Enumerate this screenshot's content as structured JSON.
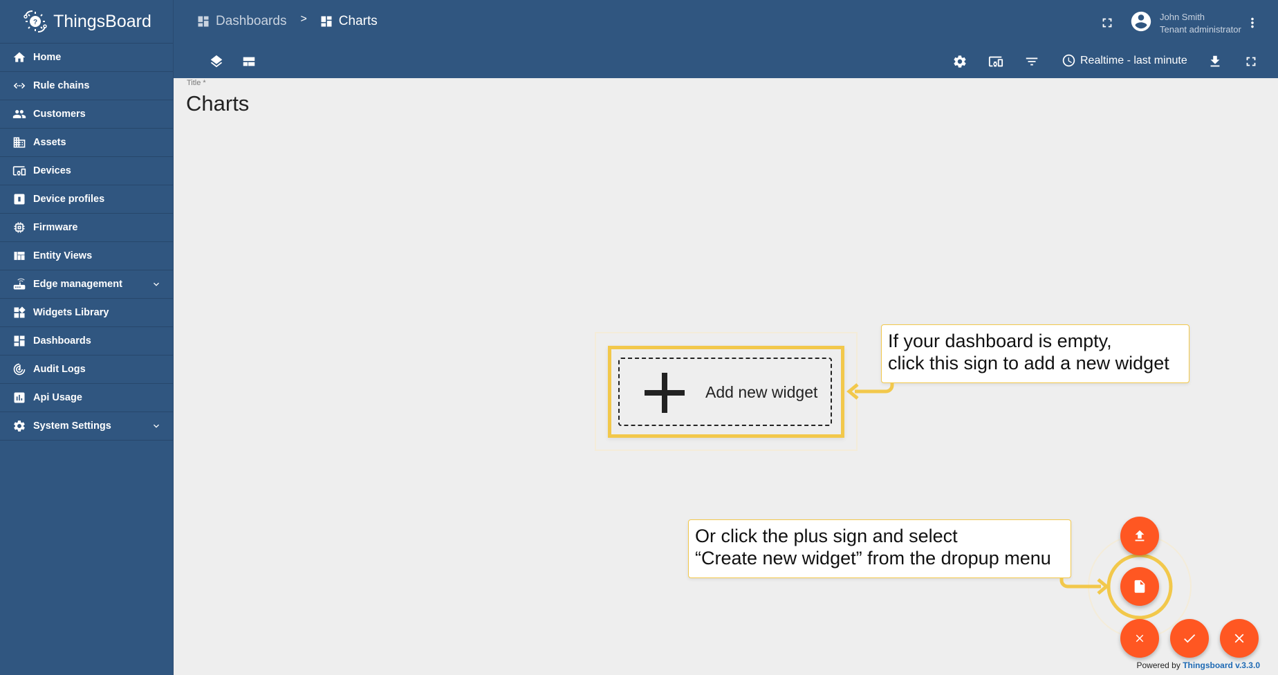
{
  "app": {
    "name": "ThingsBoard"
  },
  "sidebar": {
    "items": [
      {
        "label": "Home",
        "icon": "home-icon"
      },
      {
        "label": "Rule chains",
        "icon": "rule-chains-icon"
      },
      {
        "label": "Customers",
        "icon": "customers-icon"
      },
      {
        "label": "Assets",
        "icon": "assets-icon"
      },
      {
        "label": "Devices",
        "icon": "devices-icon"
      },
      {
        "label": "Device profiles",
        "icon": "device-profiles-icon"
      },
      {
        "label": "Firmware",
        "icon": "firmware-icon"
      },
      {
        "label": "Entity Views",
        "icon": "entity-views-icon"
      },
      {
        "label": "Edge management",
        "icon": "edge-icon",
        "expandable": true
      },
      {
        "label": "Widgets Library",
        "icon": "widgets-icon"
      },
      {
        "label": "Dashboards",
        "icon": "dashboards-icon"
      },
      {
        "label": "Audit Logs",
        "icon": "audit-logs-icon"
      },
      {
        "label": "Api Usage",
        "icon": "api-usage-icon"
      },
      {
        "label": "System Settings",
        "icon": "settings-icon",
        "expandable": true
      }
    ]
  },
  "header": {
    "breadcrumbs": [
      {
        "label": "Dashboards"
      },
      {
        "label": "Charts"
      }
    ],
    "separator": ">",
    "user": {
      "name": "John Smith",
      "role": "Tenant administrator"
    },
    "time_window": "Realtime - last minute"
  },
  "dashboard": {
    "title_label": "Title *",
    "title": "Charts",
    "add_widget_label": "Add new widget"
  },
  "callouts": {
    "first": [
      "If your dashboard is empty,",
      "click this sign to add a new widget"
    ],
    "second": [
      "Or click the plus sign and select",
      "“Create new widget” from the dropup menu"
    ]
  },
  "footer": {
    "powered_by": "Powered by",
    "link": "Thingsboard v.3.3.0"
  },
  "colors": {
    "primary": "#305680",
    "accent": "#ff5722",
    "highlight": "#f2c84b"
  }
}
